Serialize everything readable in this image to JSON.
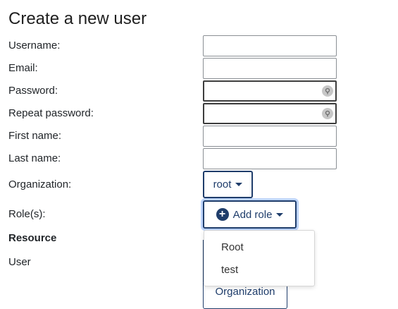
{
  "page": {
    "title": "Create a new user"
  },
  "form": {
    "username_label": "Username:",
    "email_label": "Email:",
    "password_label": "Password:",
    "repeat_password_label": "Repeat password:",
    "first_name_label": "First name:",
    "last_name_label": "Last name:",
    "organization_label": "Organization:",
    "roles_label": "Role(s):",
    "organization_value": "root",
    "add_role_label": "Add role"
  },
  "roles_menu": {
    "items": [
      "Root",
      "test"
    ]
  },
  "resource": {
    "header": "Resource",
    "row_label": "User",
    "org_button_label": "Organization"
  },
  "icons": {
    "password_reveal": "key-icon",
    "add_role": "plus-circle-icon"
  },
  "colors": {
    "accent": "#1f3d6b",
    "focus_ring": "#4285f4"
  }
}
